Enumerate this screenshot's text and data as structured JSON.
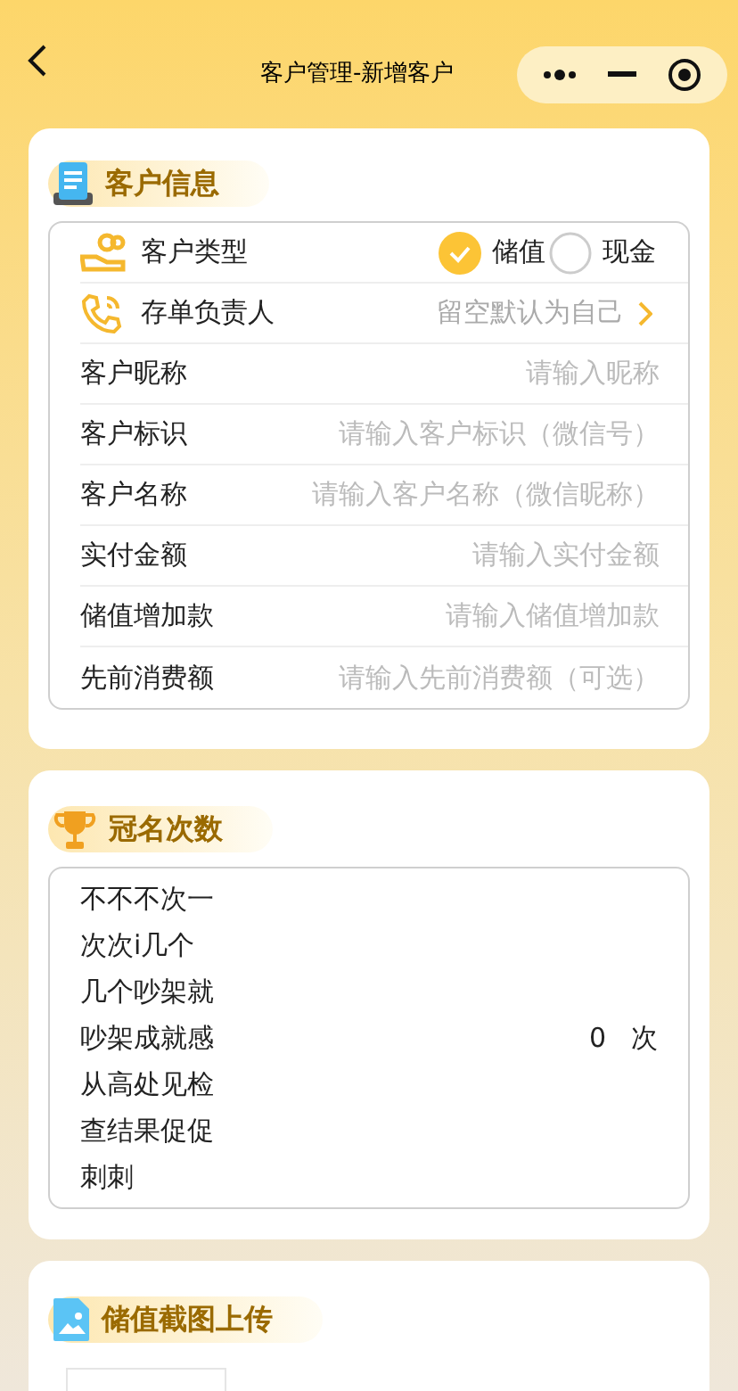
{
  "nav": {
    "title": "客户管理-新增客户"
  },
  "customer_info": {
    "title": "客户信息",
    "type_row": {
      "label": "客户类型",
      "options": [
        {
          "label": "储值",
          "selected": true
        },
        {
          "label": "现金",
          "selected": false
        }
      ]
    },
    "owner_row": {
      "label": "存单负责人",
      "value": "留空默认为自己"
    },
    "fields": [
      {
        "label": "客户昵称",
        "placeholder": "请输入昵称"
      },
      {
        "label": "客户标识",
        "placeholder": "请输入客户标识（微信号）"
      },
      {
        "label": "客户名称",
        "placeholder": "请输入客户名称（微信昵称）"
      },
      {
        "label": "实付金额",
        "placeholder": "请输入实付金额"
      },
      {
        "label": "储值增加款",
        "placeholder": "请输入储值增加款"
      },
      {
        "label": "先前消费额",
        "placeholder": "请输入先前消费额（可选）"
      }
    ]
  },
  "title_count": {
    "title": "冠名次数",
    "label": "不不不次一次次i几个几个吵架就吵架成就感从高处见检查结果促促刺刺",
    "value": "0",
    "unit": "次"
  },
  "upload": {
    "title": "储值截图上传"
  }
}
